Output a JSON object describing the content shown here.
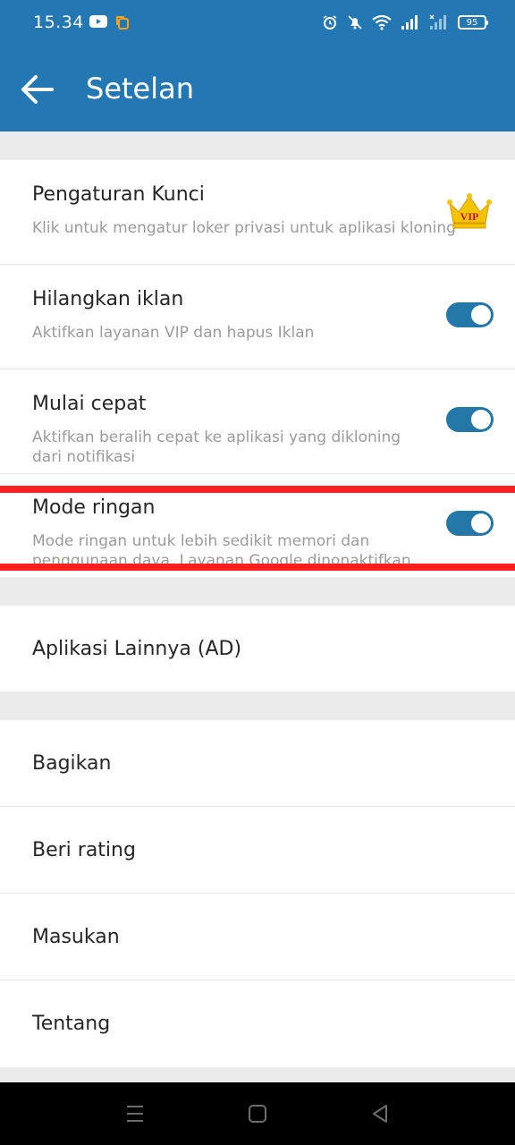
{
  "status_bar": {
    "time": "15.34",
    "battery": "95",
    "icons": [
      "youtube-icon",
      "copy-icon",
      "alarm-icon",
      "bell-off-icon",
      "wifi-icon",
      "signal-icon",
      "signal-x-icon",
      "battery-icon"
    ]
  },
  "app_bar": {
    "title": "Setelan",
    "back_icon": "arrow-left-icon"
  },
  "settings": [
    {
      "title": "Pengaturan Kunci",
      "subtitle": "Klik untuk mengatur loker privasi untuk aplikasi kloning",
      "badge": "VIP"
    },
    {
      "title": "Hilangkan iklan",
      "subtitle": "Aktifkan layanan VIP dan hapus Iklan",
      "toggle_on": true
    },
    {
      "title": "Mulai cepat",
      "subtitle": "Aktifkan beralih cepat ke aplikasi yang dikloning dari notifikasi",
      "toggle_on": true
    },
    {
      "title": "Mode ringan",
      "subtitle": "Mode ringan untuk lebih sedikit memori dan penggunaan daya. Layanan Google dinonaktifkan.",
      "toggle_on": true
    }
  ],
  "other_apps": {
    "label": "Aplikasi Lainnya (AD)"
  },
  "menu": [
    {
      "label": "Bagikan"
    },
    {
      "label": "Beri rating"
    },
    {
      "label": "Masukan"
    },
    {
      "label": "Tentang"
    }
  ],
  "nav_bar": {
    "icons": [
      "menu-icon",
      "home-square-icon",
      "back-triangle-icon"
    ]
  },
  "colors": {
    "primary": "#2378b3",
    "toggle": "#2378a8",
    "highlight": "#ff1f1f",
    "crown": "#f5c400"
  }
}
